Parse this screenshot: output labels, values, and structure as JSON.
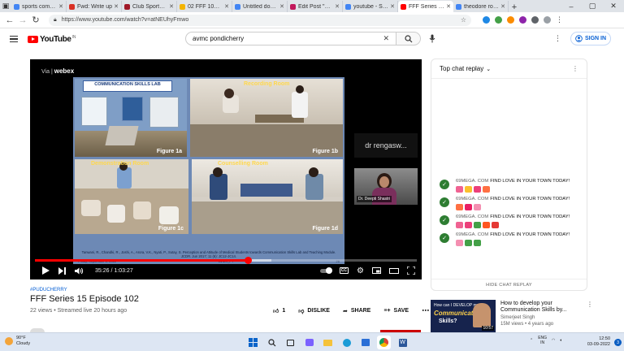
{
  "browser": {
    "tabs": [
      {
        "title": "sports committee",
        "color": "#4285f4"
      },
      {
        "title": "Fwd: Write up",
        "color": "#d93025"
      },
      {
        "title": "Club Sports - H",
        "color": "#a01828"
      },
      {
        "title": "02 FFF 102 - Go",
        "color": "#f4b400"
      },
      {
        "title": "Untitled docum",
        "color": "#4285f4"
      },
      {
        "title": "Edit Post \"Sepr",
        "color": "#c2185b"
      },
      {
        "title": "youtube - Sear",
        "color": "#4285f4"
      },
      {
        "title": "FFF Series 15 E",
        "color": "#ff0000",
        "active": true
      },
      {
        "title": "theodore roose",
        "color": "#4285f4"
      }
    ],
    "url": "https://www.youtube.com/watch?v=atNEUhyFmwo"
  },
  "youtube": {
    "logo_text": "YouTube",
    "country_code": "IN",
    "search_value": "avmc pondicherry",
    "signin_label": "SIGN IN"
  },
  "player": {
    "overlay_via": "Via",
    "overlay_brand": "webex",
    "slide": {
      "header": "COMMUNICATION SKILLS LAB",
      "rooms": [
        {
          "caption": "Recording Room",
          "figure": "Figure 1b"
        },
        {
          "caption": "Demonstration Room",
          "figure": "Figure 1c"
        },
        {
          "caption": "Counselling Room",
          "figure": "Figure 1d"
        }
      ],
      "fig_a": "Figure 1a",
      "citation": "Tanwani, R., Chandki, R., Joshi, A., Arora, V.K., Nyati, P., Sutay, S. Perception and Attitude of Medical Students towards Communication Skills Lab and Teaching Module. JCDR. Jun 2017; 11 (6): JC12-JC14.",
      "footer_left": "Friday, September 2, 2022",
      "footer_mid": "AVMC_PY",
      "footer_right": "26"
    },
    "side_caption": "dr rengasw...",
    "cam_name": "Dr. Deepti Shastri",
    "time_current": "35:26",
    "time_total": "1:03:27",
    "progress": 0.558,
    "buffered": 0.62
  },
  "video": {
    "hashtag": "#PUDUCHERRY",
    "title": "FFF Series 15 Episode 102",
    "views": "22 views",
    "streamed": "Streamed live 20 hours ago",
    "likes": "1",
    "dislike_label": "DISLIKE",
    "share_label": "SHARE",
    "save_label": "SAVE"
  },
  "chat": {
    "title": "Top chat replay",
    "messages": [
      {
        "author": "69MEGA. COM",
        "text": "FIND LOVE IN YOUR TOWN TODAY!",
        "emojis": [
          "#f06292",
          "#fbc02d",
          "#ec407a",
          "#ff7043"
        ]
      },
      {
        "author": "69MEGA. COM",
        "text": "FIND LOVE IN YOUR TOWN TODAY!",
        "emojis": [
          "#ff7043",
          "#e91e63",
          "#f48fb1"
        ]
      },
      {
        "author": "69MEGA. COM",
        "text": "FIND LOVE IN YOUR TOWN TODAY!",
        "emojis": [
          "#f06292",
          "#ec407a",
          "#43a047",
          "#ff5722",
          "#e53935"
        ]
      },
      {
        "author": "69MEGA. COM",
        "text": "FIND LOVE IN YOUR TOWN TODAY!",
        "emojis": [
          "#f48fb1",
          "#43a047",
          "#43a047"
        ]
      }
    ],
    "hide_label": "HIDE CHAT REPLAY"
  },
  "recommendation": {
    "thumb_line1": "How can I DEVELOP my",
    "thumb_line2": "Communication",
    "thumb_line3": "Skills?",
    "duration": "10:57",
    "title": "How to develop your Communication Skills by...",
    "channel": "Simerjeet Singh",
    "views": "15M views",
    "age": "4 years ago"
  },
  "taskbar": {
    "temp": "90°F",
    "weather": "Cloudy",
    "lang1": "ENG",
    "lang2": "IN",
    "time": "12:50",
    "date": "03-09-2022",
    "notif_count": "3"
  }
}
